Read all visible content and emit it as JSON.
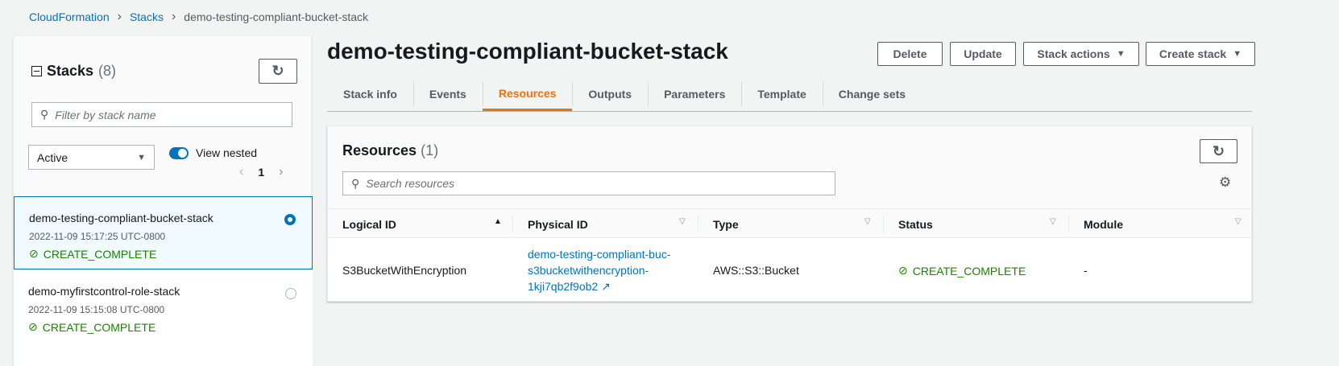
{
  "breadcrumb": {
    "items": [
      "CloudFormation",
      "Stacks"
    ],
    "current": "demo-testing-compliant-bucket-stack"
  },
  "sidebar": {
    "title": "Stacks",
    "count": "(8)",
    "filter_placeholder": "Filter by stack name",
    "status_filter": "Active",
    "view_nested_label": "View nested",
    "view_nested_on": true,
    "page": "1",
    "stacks": [
      {
        "name": "demo-testing-compliant-bucket-stack",
        "date": "2022-11-09 15:17:25 UTC-0800",
        "status": "CREATE_COMPLETE",
        "selected": true
      },
      {
        "name": "demo-myfirstcontrol-role-stack",
        "date": "2022-11-09 15:15:08 UTC-0800",
        "status": "CREATE_COMPLETE",
        "selected": false
      }
    ]
  },
  "header": {
    "title": "demo-testing-compliant-bucket-stack",
    "buttons": {
      "delete": "Delete",
      "update": "Update",
      "stack_actions": "Stack actions",
      "create_stack": "Create stack"
    }
  },
  "tabs": [
    "Stack info",
    "Events",
    "Resources",
    "Outputs",
    "Parameters",
    "Template",
    "Change sets"
  ],
  "resources": {
    "title": "Resources",
    "count": "(1)",
    "search_placeholder": "Search resources",
    "columns": [
      "Logical ID",
      "Physical ID",
      "Type",
      "Status",
      "Module"
    ],
    "rows": [
      {
        "logical_id": "S3BucketWithEncryption",
        "physical_id_lines": [
          "demo-testing-compliant-buc-",
          "s3bucketwithencryption-",
          "1kji7qb2f9ob2"
        ],
        "type": "AWS::S3::Bucket",
        "status": "CREATE_COMPLETE",
        "module": "-"
      }
    ]
  },
  "colors": {
    "link": "#0073bb",
    "success": "#1d8102",
    "accent": "#ec7211"
  }
}
